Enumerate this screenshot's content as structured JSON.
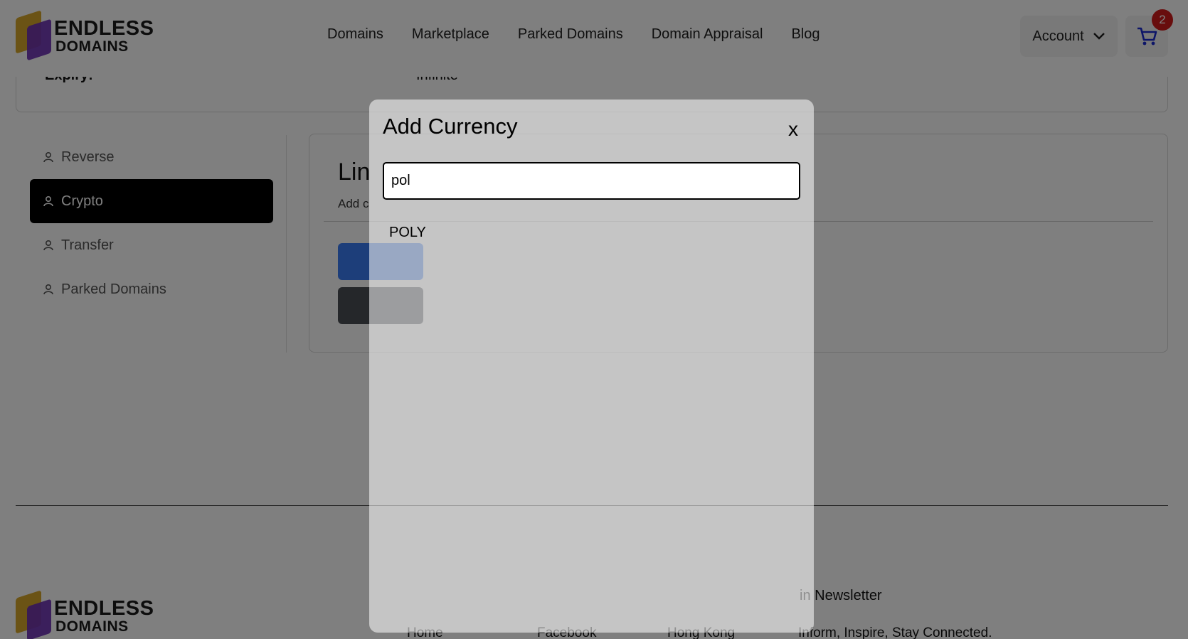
{
  "header": {
    "logo": {
      "line1": "ENDLESS",
      "line2": "DOMAINS"
    },
    "nav": [
      "Domains",
      "Marketplace",
      "Parked Domains",
      "Domain Appraisal",
      "Blog"
    ],
    "account_label": "Account",
    "cart_count": "2"
  },
  "top_card": {
    "key": "Expiry:",
    "value": "Infinite"
  },
  "sidebar": {
    "items": [
      {
        "label": "Reverse",
        "active": false
      },
      {
        "label": "Crypto",
        "active": true
      },
      {
        "label": "Transfer",
        "active": false
      },
      {
        "label": "Parked Domains",
        "active": false
      }
    ]
  },
  "content": {
    "title": "Lin",
    "subtitle": "Add c"
  },
  "footer": {
    "logo": {
      "line1": "ENDLESS",
      "line2": "DOMAINS"
    },
    "links": [
      "Home",
      "Facebook",
      "Hong Kong"
    ],
    "newsletter_title": "in Newsletter",
    "newsletter_text": "Inform, Inspire, Stay Connected."
  },
  "modal": {
    "title": "Add Currency",
    "close_label": "x",
    "search_value": "pol",
    "results": [
      "POLY"
    ]
  },
  "colors": {
    "active_item_bg": "#000000",
    "cart_badge": "#d11a1a",
    "cart_icon": "#1a2bd1",
    "primary_button": "#3a7cf5",
    "secondary_button": "#4a4f55",
    "logo_gold": "#d6a72a",
    "logo_purple": "#6b2fb3"
  }
}
